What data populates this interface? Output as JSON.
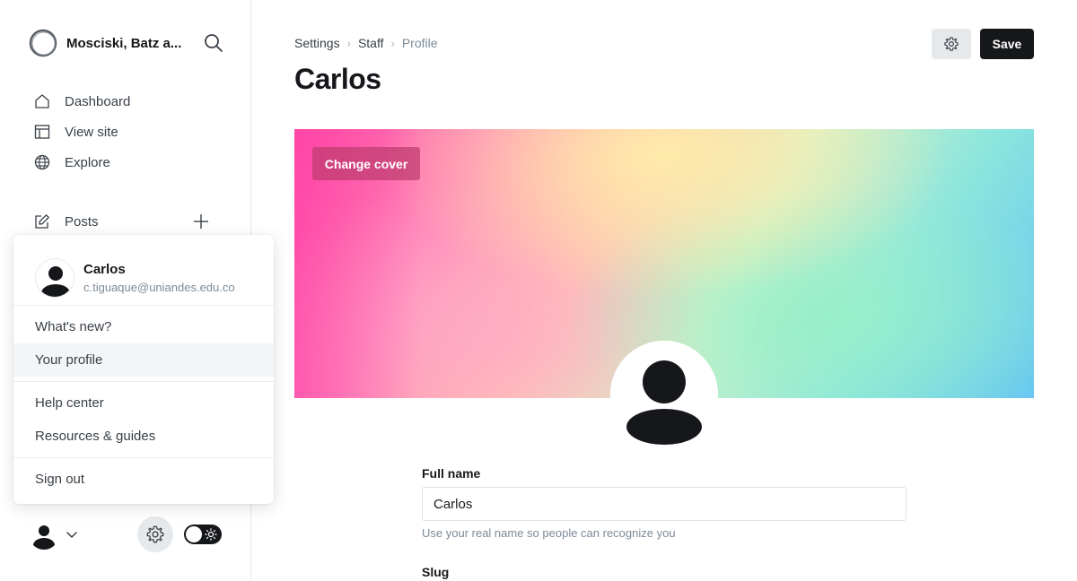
{
  "sidebar": {
    "site_name": "Mosciski, Batz a...",
    "nav": [
      {
        "label": "Dashboard",
        "icon": "home-icon"
      },
      {
        "label": "View site",
        "icon": "layout-icon"
      },
      {
        "label": "Explore",
        "icon": "globe-icon"
      }
    ],
    "posts_label": "Posts"
  },
  "popover": {
    "user_name": "Carlos",
    "user_email": "c.tiguaque@uniandes.edu.co",
    "items_group1": [
      "What's new?",
      "Your profile"
    ],
    "items_group2": [
      "Help center",
      "Resources & guides"
    ],
    "items_group3": [
      "Sign out"
    ],
    "active_item": "Your profile"
  },
  "breadcrumb": {
    "items": [
      "Settings",
      "Staff",
      "Profile"
    ],
    "separator": "›"
  },
  "page": {
    "title": "Carlos",
    "save_label": "Save",
    "change_cover_label": "Change cover"
  },
  "form": {
    "full_name_label": "Full name",
    "full_name_value": "Carlos",
    "full_name_hint": "Use your real name so people can recognize you",
    "slug_label": "Slug"
  },
  "colors": {
    "accent_dark": "#15171a",
    "muted": "#7c8b9a"
  }
}
